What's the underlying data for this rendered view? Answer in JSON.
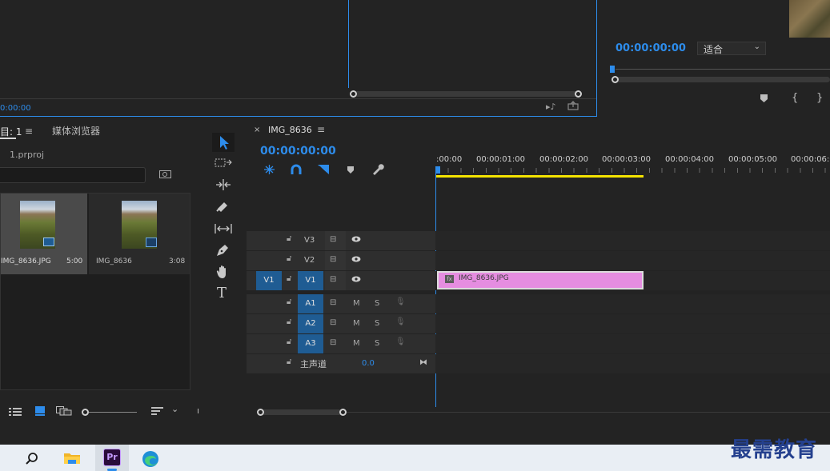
{
  "source_monitor": {
    "timecode": "0:00:00"
  },
  "program_monitor": {
    "timecode": "00:00:00:00",
    "fit_label": "适合"
  },
  "project": {
    "tab_label": "目: 1",
    "tab_media_browser": "媒体浏览器",
    "project_file": "1.prproj",
    "items": [
      {
        "name": "IMG_8636.JPG",
        "duration": "5:00"
      },
      {
        "name": "IMG_8636",
        "duration": "3:08"
      }
    ]
  },
  "timeline": {
    "sequence_name": "IMG_8636",
    "timecode": "00:00:00:00",
    "ruler_labels": [
      ":00:00",
      "00:00:01:00",
      "00:00:02:00",
      "00:00:03:00",
      "00:00:04:00",
      "00:00:05:00",
      "00:00:06:0"
    ],
    "tracks": {
      "v3": "V3",
      "v2": "V2",
      "v1": "V1",
      "v1_source": "V1",
      "a1": "A1",
      "a2": "A2",
      "a3": "A3",
      "mute": "M",
      "solo": "S",
      "master": "主声道",
      "master_value": "0.0"
    },
    "clip": {
      "name": "IMG_8636.JPG",
      "fx": "fx",
      "color": "#e58de0"
    }
  },
  "taskbar": {
    "app_label": "Pr",
    "watermark": "最需教育"
  },
  "colors": {
    "accent": "#2d8ceb",
    "clip": "#e58de0",
    "work_area": "#f4e300"
  }
}
